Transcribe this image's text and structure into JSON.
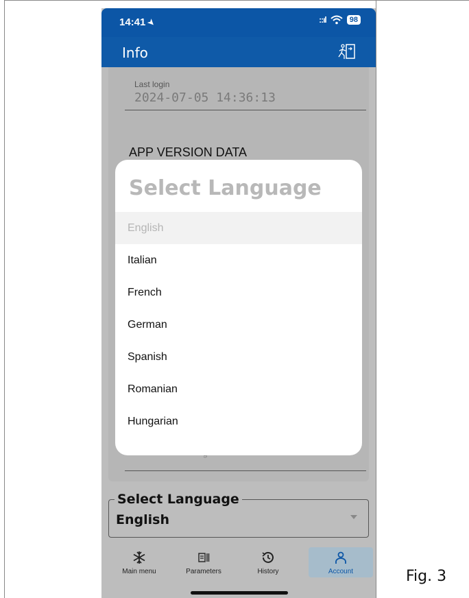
{
  "status_bar": {
    "time": "14:41",
    "battery": "98"
  },
  "app_bar": {
    "title": "Info"
  },
  "account": {
    "last_login_label": "Last login",
    "last_login_value": "2024-07-05 14:36:13",
    "app_version_heading": "APP VERSION DATA",
    "hidden_text": "g"
  },
  "language_field": {
    "label": "Select Language",
    "value": "English"
  },
  "modal": {
    "title": "Select Language",
    "options": [
      {
        "label": "English",
        "selected": true
      },
      {
        "label": "Italian"
      },
      {
        "label": "French"
      },
      {
        "label": "German"
      },
      {
        "label": "Spanish"
      },
      {
        "label": "Romanian"
      },
      {
        "label": "Hungarian"
      }
    ]
  },
  "bottom_nav": {
    "items": [
      {
        "label": "Main menu",
        "icon": "snowflake-icon"
      },
      {
        "label": "Parameters",
        "icon": "parameters-icon"
      },
      {
        "label": "History",
        "icon": "history-icon"
      },
      {
        "label": "Account",
        "icon": "account-icon",
        "active": true
      }
    ]
  },
  "figure_label": "Fig. 3",
  "colors": {
    "primary": "#0c56a6",
    "overlay": "#bdbdbd",
    "active_nav": "#a6bccb"
  }
}
